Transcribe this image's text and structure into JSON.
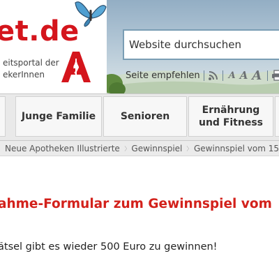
{
  "header": {
    "site_name": "et.de",
    "tagline_line1": "eitsportal der",
    "tagline_line2": "ekerInnen",
    "logo_icon": "apotheke-a-icon",
    "decoration_icon": "butterfly-icon"
  },
  "search": {
    "placeholder": "Website durchsuchen"
  },
  "tools": {
    "recommend_label": "Seite empfehlen",
    "font_small": "A",
    "font_medium": "A",
    "font_large": "A",
    "icons": [
      "rss-icon",
      "print-icon"
    ]
  },
  "nav": {
    "items": [
      {
        "label": "Junge Familie"
      },
      {
        "label": "Senioren"
      },
      {
        "label": "Ernährung\nund Fitness"
      }
    ]
  },
  "breadcrumb": {
    "items": [
      {
        "label": "Neue Apotheken Illustrierte"
      },
      {
        "label": "Gewinnspiel"
      },
      {
        "label": "Gewinnspiel vom 15"
      }
    ]
  },
  "content": {
    "title": "ahme-Formular zum Gewinnspiel vom",
    "intro": "ätsel gibt es wieder 500 Euro zu gewinnen!"
  },
  "colors": {
    "brand_red": "#d4151c",
    "title_red": "#d3211b",
    "search_border": "#7a9db4",
    "nav_background": "#e9e9e9"
  }
}
